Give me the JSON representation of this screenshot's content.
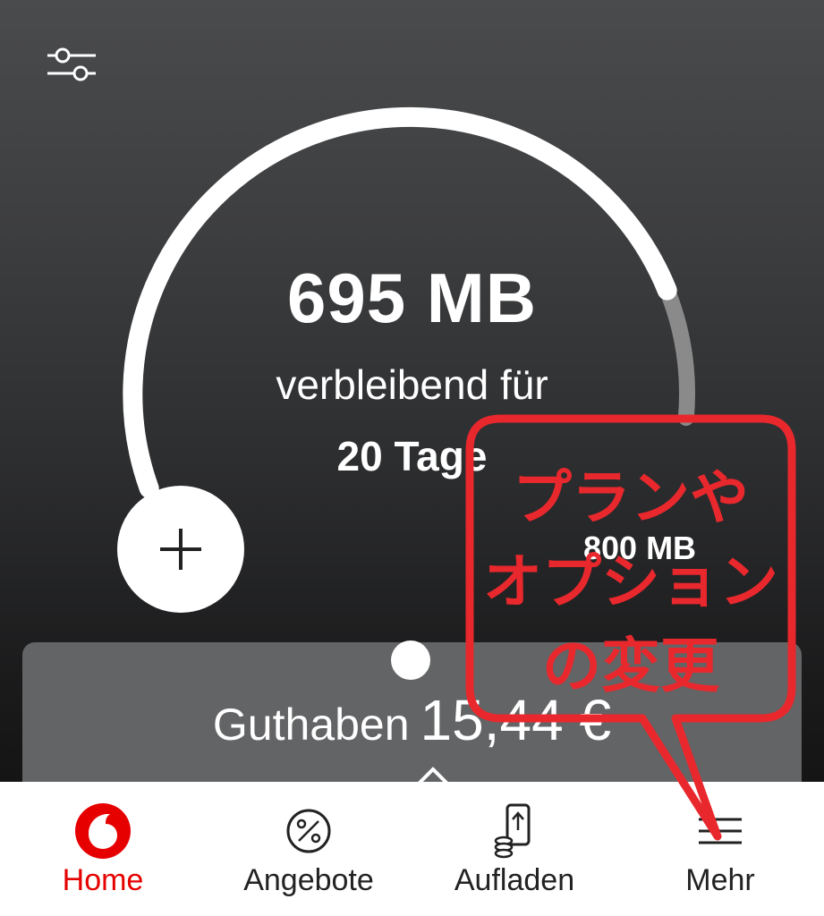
{
  "usage": {
    "remaining_amount": "695 MB",
    "remaining_label": "verbleibend für",
    "days_left": "20 Tage",
    "total_amount": "800 MB",
    "remaining_fraction": 0.869
  },
  "balance": {
    "label": "Guthaben",
    "value": "15,44 €"
  },
  "tabs": [
    {
      "label": "Home",
      "icon": "vodafone-logo-icon",
      "active": true
    },
    {
      "label": "Angebote",
      "icon": "percent-icon",
      "active": false
    },
    {
      "label": "Aufladen",
      "icon": "top-up-phone-icon",
      "active": false
    },
    {
      "label": "Mehr",
      "icon": "menu-icon",
      "active": false
    }
  ],
  "annotation": {
    "lines": [
      "プランや",
      "オプション",
      "の変更"
    ],
    "color": "#e8282d"
  },
  "colors": {
    "brand_red": "#e60000",
    "gauge_track": "#8a8a8a",
    "gauge_fill": "#ffffff"
  },
  "icons": {
    "filter": "sliders-icon",
    "add": "plus-icon",
    "expand": "chevron-up-icon"
  }
}
